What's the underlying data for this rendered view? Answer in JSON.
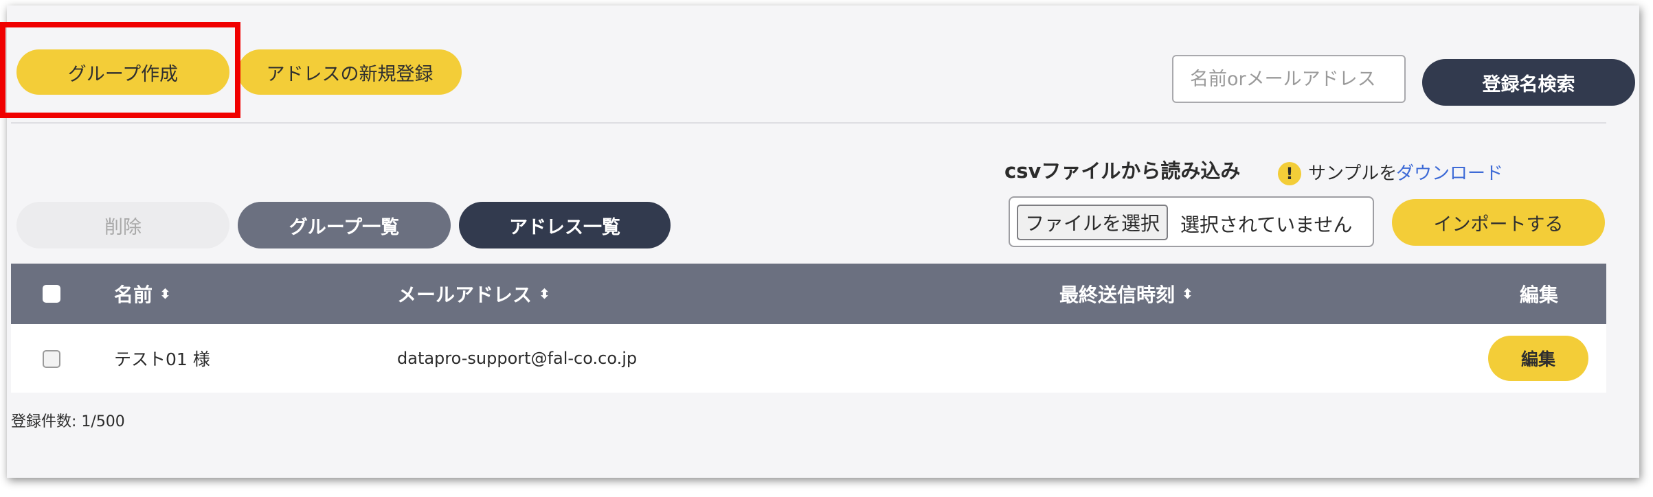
{
  "toolbar": {
    "create_group_label": "グループ作成",
    "register_address_label": "アドレスの新規登録",
    "search_placeholder": "名前orメールアドレス",
    "search_button_label": "登録名検索"
  },
  "csv": {
    "title": "csvファイルから読み込み",
    "warning_icon_glyph": "!",
    "sample_text": "サンプルを",
    "sample_link_label": "ダウンロード",
    "file_button_label": "ファイルを選択",
    "file_status": "選択されていません",
    "import_button_label": "インポートする"
  },
  "actions": {
    "delete_label": "削除",
    "group_list_label": "グループ一覧",
    "address_list_label": "アドレス一覧"
  },
  "table": {
    "columns": [
      "名前",
      "メールアドレス",
      "最終送信時刻",
      "編集"
    ],
    "sort_glyph": "⬍",
    "rows": [
      {
        "name": "テスト01 様",
        "email": "datapro-support@fal-co.co.jp",
        "last_sent": "",
        "edit_label": "編集"
      }
    ]
  },
  "footer": {
    "count_text": "登録件数: 1/500"
  },
  "colors": {
    "accent_yellow": "#f3cd38",
    "navy": "#323a4e",
    "header_grey": "#6b7080",
    "highlight_red": "#f00000",
    "link_blue": "#3d6ad6"
  }
}
